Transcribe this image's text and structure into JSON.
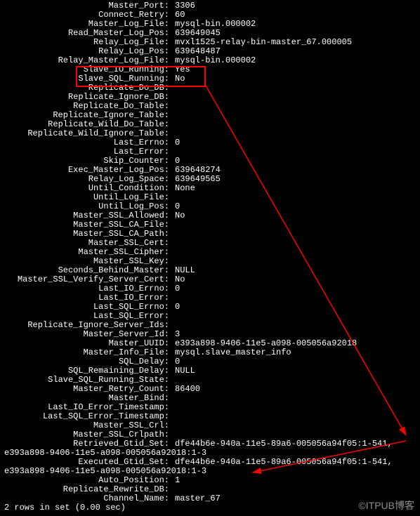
{
  "status": [
    {
      "label": "Master_Port:",
      "value": "3306"
    },
    {
      "label": "Connect_Retry:",
      "value": "60"
    },
    {
      "label": "Master_Log_File:",
      "value": "mysql-bin.000002"
    },
    {
      "label": "Read_Master_Log_Pos:",
      "value": "639649045"
    },
    {
      "label": "Relay_Log_File:",
      "value": "mvxl1525-relay-bin-master_67.000005"
    },
    {
      "label": "Relay_Log_Pos:",
      "value": "639648487"
    },
    {
      "label": "Relay_Master_Log_File:",
      "value": "mysql-bin.000002"
    },
    {
      "label": "Slave_IO_Running:",
      "value": "Yes"
    },
    {
      "label": "Slave_SQL_Running:",
      "value": "No"
    },
    {
      "label": "Replicate_Do_DB:",
      "value": ""
    },
    {
      "label": "Replicate_Ignore_DB:",
      "value": ""
    },
    {
      "label": "Replicate_Do_Table:",
      "value": ""
    },
    {
      "label": "Replicate_Ignore_Table:",
      "value": ""
    },
    {
      "label": "Replicate_Wild_Do_Table:",
      "value": ""
    },
    {
      "label": "Replicate_Wild_Ignore_Table:",
      "value": ""
    },
    {
      "label": "Last_Errno:",
      "value": "0"
    },
    {
      "label": "Last_Error:",
      "value": ""
    },
    {
      "label": "Skip_Counter:",
      "value": "0"
    },
    {
      "label": "Exec_Master_Log_Pos:",
      "value": "639648274"
    },
    {
      "label": "Relay_Log_Space:",
      "value": "639649565"
    },
    {
      "label": "Until_Condition:",
      "value": "None"
    },
    {
      "label": "Until_Log_File:",
      "value": ""
    },
    {
      "label": "Until_Log_Pos:",
      "value": "0"
    },
    {
      "label": "Master_SSL_Allowed:",
      "value": "No"
    },
    {
      "label": "Master_SSL_CA_File:",
      "value": ""
    },
    {
      "label": "Master_SSL_CA_Path:",
      "value": ""
    },
    {
      "label": "Master_SSL_Cert:",
      "value": ""
    },
    {
      "label": "Master_SSL_Cipher:",
      "value": ""
    },
    {
      "label": "Master_SSL_Key:",
      "value": ""
    },
    {
      "label": "Seconds_Behind_Master:",
      "value": "NULL"
    },
    {
      "label": "Master_SSL_Verify_Server_Cert:",
      "value": "No"
    },
    {
      "label": "Last_IO_Errno:",
      "value": "0"
    },
    {
      "label": "Last_IO_Error:",
      "value": ""
    },
    {
      "label": "Last_SQL_Errno:",
      "value": "0"
    },
    {
      "label": "Last_SQL_Error:",
      "value": ""
    },
    {
      "label": "Replicate_Ignore_Server_Ids:",
      "value": ""
    },
    {
      "label": "Master_Server_Id:",
      "value": "3"
    },
    {
      "label": "Master_UUID:",
      "value": "e393a898-9406-11e5-a098-005056a92018"
    },
    {
      "label": "Master_Info_File:",
      "value": "mysql.slave_master_info"
    },
    {
      "label": "SQL_Delay:",
      "value": "0"
    },
    {
      "label": "SQL_Remaining_Delay:",
      "value": "NULL"
    },
    {
      "label": "Slave_SQL_Running_State:",
      "value": ""
    },
    {
      "label": "Master_Retry_Count:",
      "value": "86400"
    },
    {
      "label": "Master_Bind:",
      "value": ""
    },
    {
      "label": "Last_IO_Error_Timestamp:",
      "value": ""
    },
    {
      "label": "Last_SQL_Error_Timestamp:",
      "value": ""
    },
    {
      "label": "Master_SSL_Crl:",
      "value": ""
    },
    {
      "label": "Master_SSL_Crlpath:",
      "value": ""
    },
    {
      "label": "Retrieved_Gtid_Set:",
      "value": "dfe44b6e-940a-11e5-89a6-005056a94f05:1-541,",
      "cont": "e393a898-9406-11e5-a098-005056a92018:1-3"
    },
    {
      "label": "Executed_Gtid_Set:",
      "value": "dfe44b6e-940a-11e5-89a6-005056a94f05:1-541,",
      "cont": "e393a898-9406-11e5-a098-005056a92018:1-3"
    },
    {
      "label": "Auto_Position:",
      "value": "1"
    },
    {
      "label": "Replicate_Rewrite_DB:",
      "value": ""
    },
    {
      "label": "Channel_Name:",
      "value": "master_67"
    }
  ],
  "footer": "2 rows in set (0.00 sec)",
  "watermark": "©ITPUB博客"
}
